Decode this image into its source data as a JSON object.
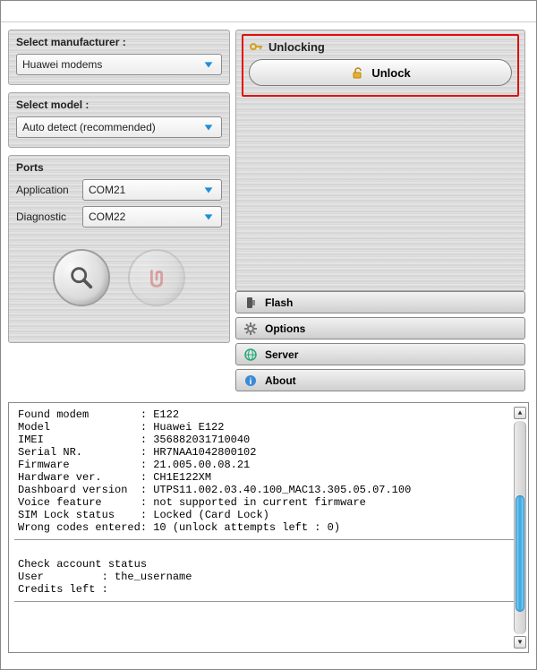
{
  "manufacturer": {
    "group_label": "Select manufacturer :",
    "value": "Huawei modems"
  },
  "model": {
    "group_label": "Select model :",
    "value": "Auto detect (recommended)"
  },
  "ports": {
    "group_label": "Ports",
    "application_label": "Application",
    "application_value": "COM21",
    "diagnostic_label": "Diagnostic",
    "diagnostic_value": "COM22"
  },
  "unlocking": {
    "header": "Unlocking",
    "button_label": "Unlock"
  },
  "nav": {
    "flash": "Flash",
    "options": "Options",
    "server": "Server",
    "about": "About"
  },
  "log": {
    "labels": {
      "found_modem": "Found modem",
      "model": "Model",
      "imei": "IMEI",
      "serial_nr": "Serial NR.",
      "firmware": "Firmware",
      "hardware_ver": "Hardware ver.",
      "dashboard_version": "Dashboard version",
      "voice_feature": "Voice feature",
      "sim_lock_status": "SIM Lock status",
      "wrong_codes_entered": "Wrong codes entered",
      "check_account": "Check account status",
      "user": "User",
      "credits_left": "Credits left"
    },
    "values": {
      "found_modem": "E122",
      "model": "Huawei E122",
      "imei": "356882031710040",
      "serial_nr": "HR7NAA1042800102",
      "firmware": "21.005.00.08.21",
      "hardware_ver": "CH1E122XM",
      "dashboard_version": "UTPS11.002.03.40.100_MAC13.305.05.07.100",
      "voice_feature": "not supported in current firmware",
      "sim_lock_status": "Locked (Card Lock)",
      "wrong_codes_entered": "10 (unlock attempts left : 0)",
      "user": "the_username",
      "credits_left": ""
    }
  }
}
